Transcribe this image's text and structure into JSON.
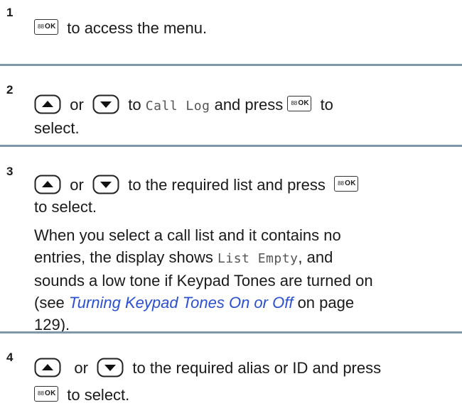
{
  "steps": [
    {
      "number": "1",
      "text": {
        "a": "to access the menu."
      }
    },
    {
      "number": "2",
      "text": {
        "or": "or",
        "to": "to",
        "mono": "Call Log",
        "and_press": "and press",
        "to_end": "to",
        "select": "select."
      }
    },
    {
      "number": "3",
      "text": {
        "or": "or",
        "mid": "to the required list and press",
        "select": "to select.",
        "para1": "When you select a call list and it contains no",
        "para2a": "entries, the display shows",
        "para2_mono": "List Empty",
        "para2b": ", and",
        "para3": "sounds a low tone if Keypad Tones are turned on",
        "para4a": "(see",
        "para4_link": "Turning Keypad Tones On or Off",
        "para4b": "on page",
        "para5": "129)."
      }
    },
    {
      "number": "4",
      "text": {
        "or": "or",
        "mid": "to the required alias or ID and press",
        "select": "to select."
      }
    }
  ],
  "icons": {
    "ok_button": "menu-ok-button-icon",
    "up_button": "up-arrow-button-icon",
    "down_button": "down-arrow-button-icon",
    "ok_label": "OK",
    "ok_grid": "88"
  },
  "colors": {
    "divider": "#7f97ab",
    "link": "#2a4fd1",
    "mono": "#555555"
  }
}
